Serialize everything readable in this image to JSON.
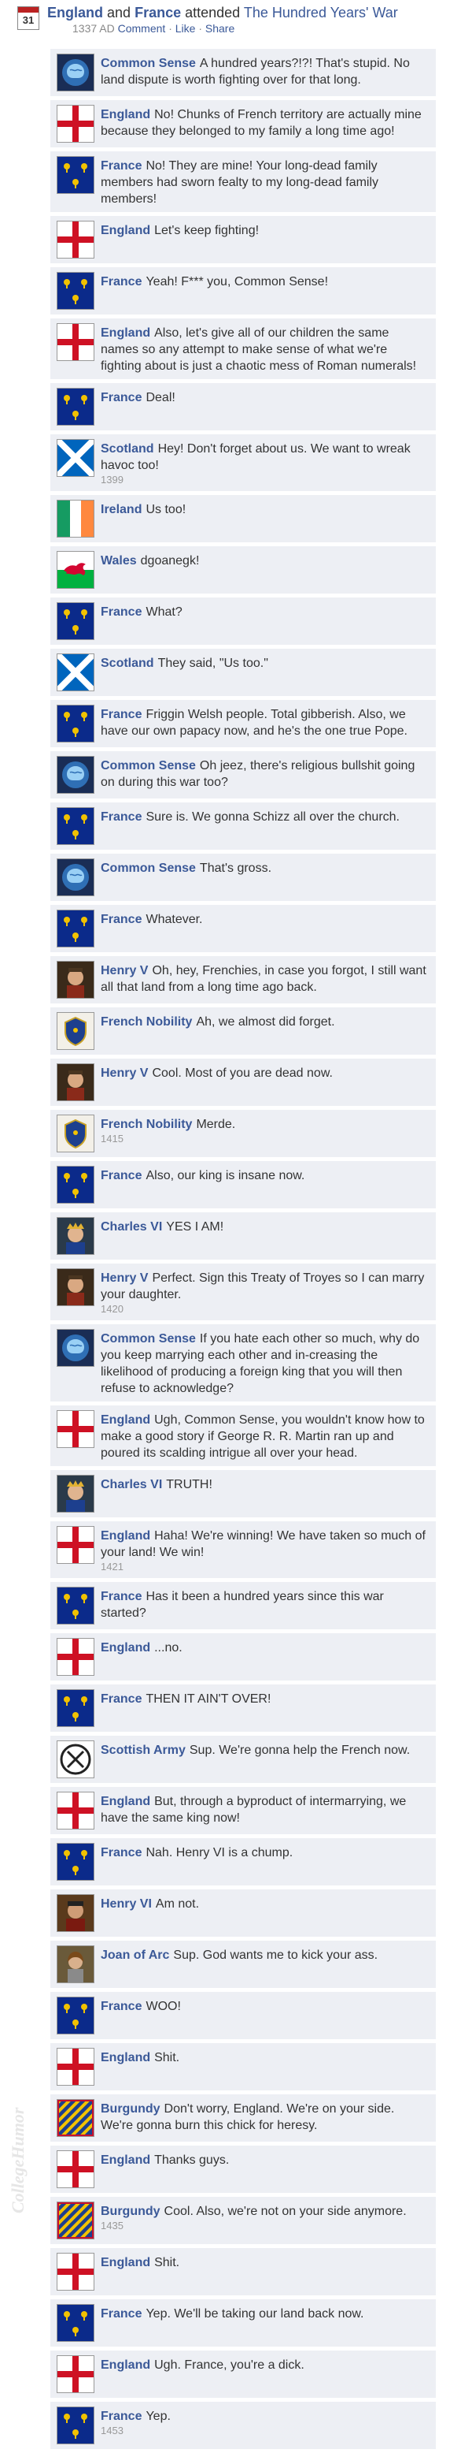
{
  "header": {
    "calendar_day": "31",
    "party1": "England",
    "and": "and",
    "party2": "France",
    "attended": "attended",
    "event": "The Hundred Years' War",
    "date": "1337 AD",
    "comment": "Comment",
    "like": "Like",
    "share": "Share",
    "sep": "·"
  },
  "watermark": "CollegeHumor",
  "posts": [
    {
      "name": "Common Sense",
      "avatar": "brain",
      "text": "A hundred years?!?! That's stupid. No land dispute is worth fighting over for that long."
    },
    {
      "name": "England",
      "avatar": "england",
      "text": "No! Chunks of French territory are actually mine because they belonged to my family a long time ago!"
    },
    {
      "name": "France",
      "avatar": "france",
      "text": "No! They are mine! Your long-dead family members had sworn fealty to my long-dead family members!"
    },
    {
      "name": "England",
      "avatar": "england",
      "text": "Let's keep fighting!"
    },
    {
      "name": "France",
      "avatar": "france",
      "text": "Yeah! F*** you, Common Sense!"
    },
    {
      "name": "England",
      "avatar": "england",
      "text": "Also, let's give all of our children the same names so any attempt to make sense of what we're fighting about is just a chaotic mess of Roman numerals!"
    },
    {
      "name": "France",
      "avatar": "france",
      "text": "Deal!"
    },
    {
      "name": "Scotland",
      "avatar": "scotland",
      "text": "Hey! Don't forget about us. We want to wreak havoc too!",
      "year": "1399"
    },
    {
      "name": "Ireland",
      "avatar": "ireland",
      "text": "Us too!"
    },
    {
      "name": "Wales",
      "avatar": "wales",
      "text": "dgoanegk!"
    },
    {
      "name": "France",
      "avatar": "france",
      "text": "What?"
    },
    {
      "name": "Scotland",
      "avatar": "scotland",
      "text": "They said, \"Us too.\""
    },
    {
      "name": "France",
      "avatar": "france",
      "text": "Friggin Welsh people. Total gibberish. Also, we have our own papacy now, and he's the one true Pope."
    },
    {
      "name": "Common Sense",
      "avatar": "brain",
      "text": "Oh jeez, there's religious bullshit going on during this war too?"
    },
    {
      "name": "France",
      "avatar": "france",
      "text": "Sure is. We gonna Schizz all over the church."
    },
    {
      "name": "Common Sense",
      "avatar": "brain",
      "text": "That's gross."
    },
    {
      "name": "France",
      "avatar": "france",
      "text": "Whatever."
    },
    {
      "name": "Henry V",
      "avatar": "henry5",
      "text": "Oh, hey, Frenchies, in case you forgot, I still want all that land from a long time ago back."
    },
    {
      "name": "French Nobility",
      "avatar": "nobility",
      "text": "Ah, we almost did forget."
    },
    {
      "name": "Henry V",
      "avatar": "henry5",
      "text": "Cool. Most of you are dead now."
    },
    {
      "name": "French Nobility",
      "avatar": "nobility",
      "text": "Merde.",
      "year": "1415"
    },
    {
      "name": "France",
      "avatar": "france",
      "text": "Also, our king is insane now."
    },
    {
      "name": "Charles VI",
      "avatar": "charles6",
      "text": "YES I AM!"
    },
    {
      "name": "Henry V",
      "avatar": "henry5",
      "text": "Perfect. Sign this Treaty of Troyes so I can marry your daughter.",
      "year": "1420"
    },
    {
      "name": "Common Sense",
      "avatar": "brain",
      "text": "If you hate each other so much, why do you keep marrying each other and in-creasing the likelihood of producing a foreign king that you will then refuse to acknowledge?"
    },
    {
      "name": "England",
      "avatar": "england",
      "text": "Ugh, Common Sense, you wouldn't know how to make a good story if George R. R. Martin ran up and poured its scalding intrigue all over your head."
    },
    {
      "name": "Charles VI",
      "avatar": "charles6",
      "text": "TRUTH!"
    },
    {
      "name": "England",
      "avatar": "england",
      "text": "Haha! We're winning! We have taken so much of your land! We win!",
      "year": "1421"
    },
    {
      "name": "France",
      "avatar": "france",
      "text": "Has it been a hundred years since this war started?"
    },
    {
      "name": "England",
      "avatar": "england",
      "text": "...no."
    },
    {
      "name": "France",
      "avatar": "france",
      "text": "THEN IT AIN'T OVER!"
    },
    {
      "name": "Scottish Army",
      "avatar": "scottish_army",
      "text": "Sup. We're gonna help the French now."
    },
    {
      "name": "England",
      "avatar": "england",
      "text": "But, through a byproduct of intermarrying, we have the same king now!"
    },
    {
      "name": "France",
      "avatar": "france",
      "text": "Nah. Henry VI is a chump."
    },
    {
      "name": "Henry VI",
      "avatar": "henry6",
      "text": "Am not."
    },
    {
      "name": "Joan of Arc",
      "avatar": "joan",
      "text": "Sup. God wants me to kick your ass."
    },
    {
      "name": "France",
      "avatar": "france",
      "text": "WOO!"
    },
    {
      "name": "England",
      "avatar": "england",
      "text": "Shit."
    },
    {
      "name": "Burgundy",
      "avatar": "burgundy",
      "text": "Don't worry, England. We're on your side. We're gonna burn this chick for heresy."
    },
    {
      "name": "England",
      "avatar": "england",
      "text": "Thanks guys."
    },
    {
      "name": "Burgundy",
      "avatar": "burgundy",
      "text": "Cool. Also, we're not on your side anymore.",
      "year": "1435"
    },
    {
      "name": "England",
      "avatar": "england",
      "text": "Shit."
    },
    {
      "name": "France",
      "avatar": "france",
      "text": "Yep. We'll be taking our land back now."
    },
    {
      "name": "England",
      "avatar": "england",
      "text": "Ugh. France, you're a dick."
    },
    {
      "name": "France",
      "avatar": "france",
      "text": "Yep.",
      "year": "1453"
    }
  ]
}
